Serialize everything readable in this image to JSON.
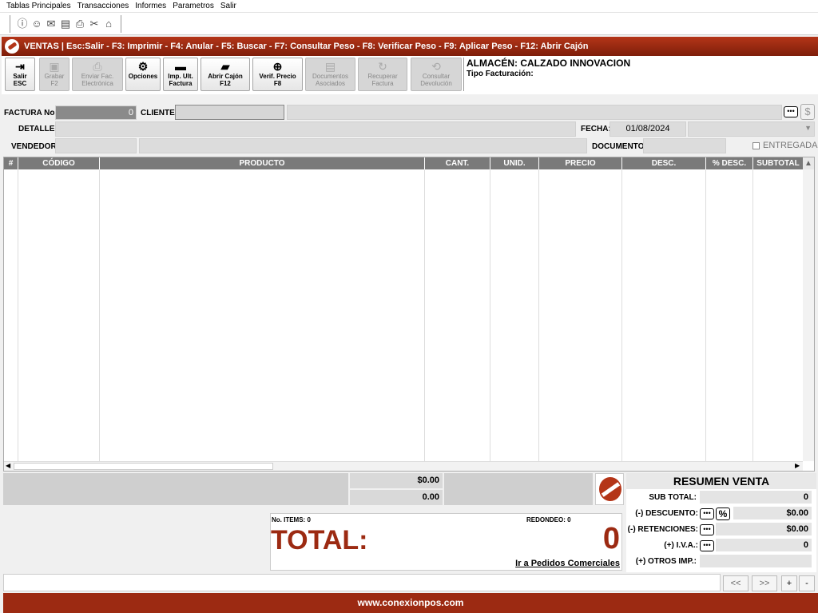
{
  "menu": [
    "Tablas Principales",
    "Transacciones",
    "Informes",
    "Parametros",
    "Salir"
  ],
  "window_title": "VENTAS | Esc:Salir - F3: Imprimir - F4: Anular - F5: Buscar - F7: Consultar Peso - F8: Verificar Peso - F9: Aplicar Peso - F12: Abrir Cajón",
  "toolbar": {
    "salir": [
      "Salir",
      "ESC"
    ],
    "grabar": [
      "Grabar",
      "F2"
    ],
    "enviar": [
      "Enviar Fac.",
      "Electrónica"
    ],
    "opciones": "Opciones",
    "imp": [
      "Imp. Ult.",
      "Factura"
    ],
    "cajon": [
      "Abrir Cajón",
      "F12"
    ],
    "verif": [
      "Verif. Precio",
      "F8"
    ],
    "docs": [
      "Documentos",
      "Asociados"
    ],
    "recuperar": [
      "Recuperar",
      "Factura"
    ],
    "consultar": [
      "Consultar",
      "Devolución"
    ]
  },
  "almacen_label": "ALMACÉN:",
  "almacen": "CALZADO INNOVACION",
  "tipo_facturacion_label": "Tipo Facturación:",
  "form": {
    "factura_label": "FACTURA No.:",
    "factura_value": "0",
    "cliente_label": "CLIENTE:",
    "detalle_label": "DETALLE:",
    "fecha_label": "FECHA:",
    "fecha_value": "01/08/2024",
    "vendedor_label": "VENDEDOR:",
    "documento_label": "DOCUMENTO:",
    "entregada_label": "ENTREGADA",
    "entregada_checked": false
  },
  "grid_columns": [
    "#",
    "CÓDIGO",
    "PRODUCTO",
    "CANT.",
    "UNID.",
    "PRECIO",
    "DESC.",
    "% DESC.",
    "SUBTOTAL"
  ],
  "totals_row": {
    "amount1": "$0.00",
    "amount2": "0.00"
  },
  "total_box": {
    "items_label": "No. ITEMS: 0",
    "redondeo_label": "REDONDEO: 0",
    "total_label": "TOTAL:",
    "total_value": "0",
    "link": "Ir a Pedidos Comerciales"
  },
  "resumen": {
    "title": "RESUMEN VENTA",
    "subtotal_label": "SUB TOTAL:",
    "subtotal": "0",
    "descuento_label": "(-) DESCUENTO:",
    "descuento": "$0.00",
    "retenciones_label": "(-) RETENCIONES:",
    "retenciones": "$0.00",
    "iva_label": "(+) I.V.A.:",
    "iva": "0",
    "otros_label": "(+) OTROS IMP.:",
    "otros": ""
  },
  "nav": [
    "<<",
    ">>",
    "+",
    "-"
  ],
  "footer": "www.conexionpos.com",
  "colors": {
    "brand": "#9c2a12",
    "total": "#9c2a12"
  }
}
